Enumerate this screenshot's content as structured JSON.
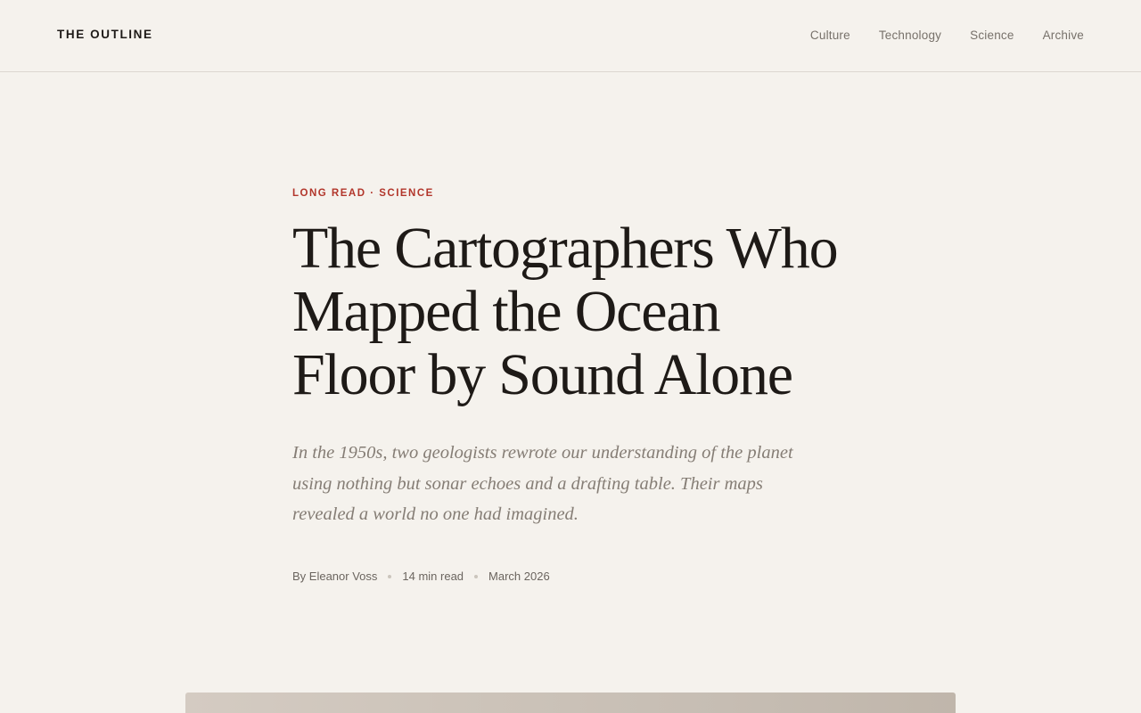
{
  "site": {
    "logo": "THE OUTLINE"
  },
  "nav": {
    "items": [
      {
        "label": "Culture"
      },
      {
        "label": "Technology"
      },
      {
        "label": "Science"
      },
      {
        "label": "Archive"
      }
    ]
  },
  "article": {
    "kicker": "LONG READ · SCIENCE",
    "headline": "The Cartographers Who Mapped the Ocean Floor by Sound Alone",
    "dek": "In the 1950s, two geologists rewrote our understanding of the planet using nothing but sonar echoes and a drafting table. Their maps revealed a world no one had imagined.",
    "byline": {
      "author": "By Eleanor Voss",
      "read_time": "14 min read",
      "date": "March 2026"
    }
  },
  "colors": {
    "background": "#f5f2ed",
    "accent": "#b2362b",
    "text": "#1e1a17",
    "muted": "#857d75"
  }
}
